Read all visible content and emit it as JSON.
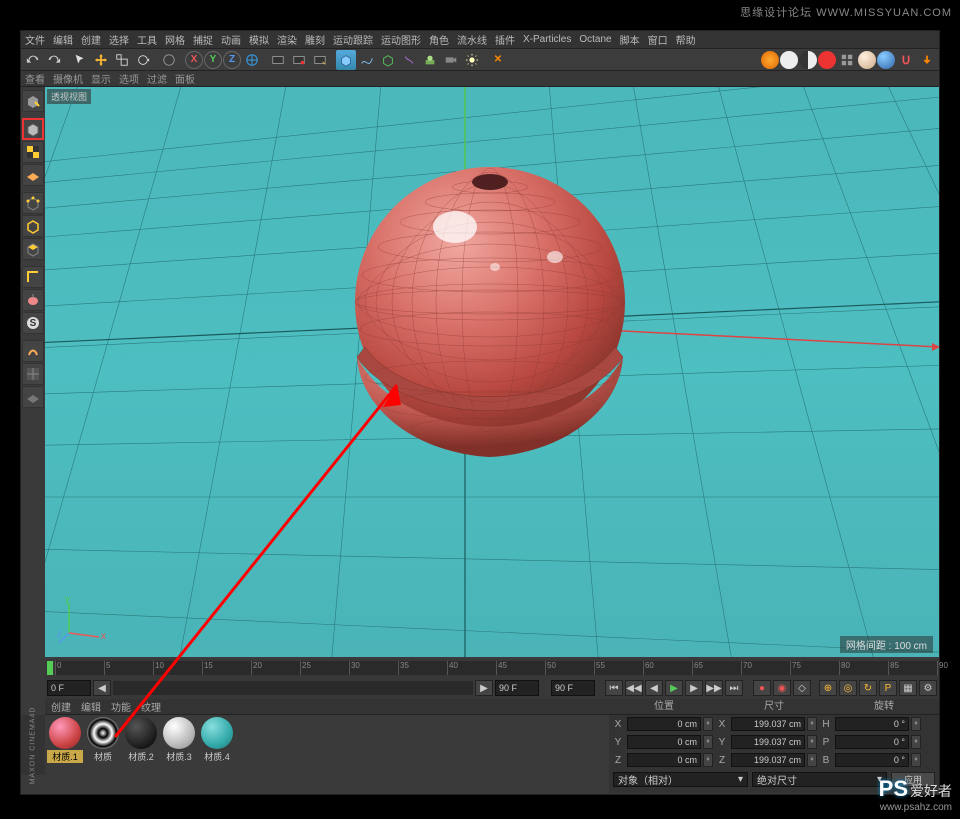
{
  "watermark": {
    "top": "思缘设计论坛 WWW.MISSYUAN.COM",
    "ps": "PS",
    "txt": "爱好者",
    "url": "www.psahz.com"
  },
  "menu": [
    "文件",
    "编辑",
    "创建",
    "选择",
    "工具",
    "网格",
    "捕捉",
    "动画",
    "模拟",
    "渲染",
    "雕刻",
    "运动跟踪",
    "运动图形",
    "角色",
    "流水线",
    "插件",
    "X-Particles",
    "Octane",
    "脚本",
    "窗口",
    "帮助"
  ],
  "viewmenu": [
    "查看",
    "摄像机",
    "显示",
    "选项",
    "过滤",
    "面板"
  ],
  "viewport_label": "透视视图",
  "grid_status": "网格间距 : 100 cm",
  "timeline": {
    "start": "0 F",
    "end": "90 F",
    "cur": "90 F",
    "ticks": [
      0,
      5,
      10,
      15,
      20,
      25,
      30,
      35,
      40,
      45,
      50,
      55,
      60,
      65,
      70,
      75,
      80,
      85,
      90
    ]
  },
  "matmenu": [
    "创建",
    "编辑",
    "功能",
    "纹理"
  ],
  "materials": [
    {
      "name": "材质.1",
      "color": "radial-gradient(circle at 35% 30%,#f9b,#c44 60%,#822)"
    },
    {
      "name": "材质",
      "color": "radial-gradient(circle at 50% 50%,#fff 0%,#000 20%,#fff 40%,#000 60%,#fff 80%)"
    },
    {
      "name": "材质.2",
      "color": "radial-gradient(circle at 35% 30%,#555,#000)"
    },
    {
      "name": "材质.3",
      "color": "radial-gradient(circle at 35% 30%,#fff,#bbb 60%,#888)"
    },
    {
      "name": "材质.4",
      "color": "radial-gradient(circle at 35% 30%,#8dd,#3aa 60%,#277)"
    }
  ],
  "coord": {
    "headers": [
      "位置",
      "尺寸",
      "旋转"
    ],
    "rows": [
      {
        "axis": "X",
        "pos": "0 cm",
        "size": "199.037 cm",
        "rot": "0 °",
        "r": "H"
      },
      {
        "axis": "Y",
        "pos": "0 cm",
        "size": "199.037 cm",
        "rot": "0 °",
        "r": "P"
      },
      {
        "axis": "Z",
        "pos": "0 cm",
        "size": "199.037 cm",
        "rot": "0 °",
        "r": "B"
      }
    ],
    "sel1": "对象（相对）",
    "sel2": "绝对尺寸",
    "apply": "应用"
  },
  "brand": "MAXON CINEMA4D"
}
